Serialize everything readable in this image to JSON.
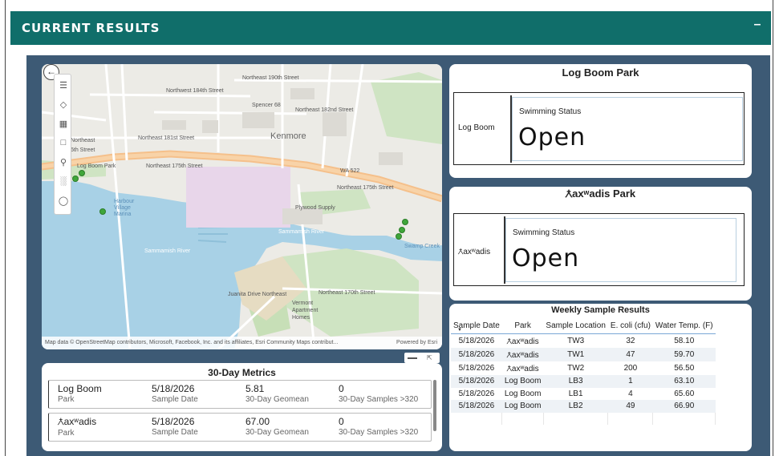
{
  "header": {
    "title": "CURRENT RESULTS",
    "collapse_label": "–"
  },
  "map": {
    "attribution": "Map data © OpenStreetMap contributors, Microsoft, Facebook, Inc. and its affiliates, Esri Community Maps contribut...",
    "powered_by": "Powered by Esri",
    "back_icon": "back-arrow-icon",
    "tools": [
      "menu-icon",
      "layers-icon",
      "basemap-icon",
      "select-icon",
      "search-icon",
      "legend-icon",
      "person-icon"
    ],
    "labels": {
      "kenmore": "Kenmore",
      "spencer": "Spencer 68",
      "log_boom_park": "Log Boom Park",
      "plywood": "Plywood Supply",
      "sammamish_river": "Sammamish River",
      "sammamish_river2": "Sammamish River",
      "wa522": "WA 522",
      "ne_175th": "Northeast 175th Street",
      "ne_175th_b": "Northeast 175th Street",
      "ne_181st": "Northeast 181st Street",
      "ne_182nd": "Northeast 182nd Street",
      "ne_184th": "Northwest 184th Street",
      "ne_170th": "Northeast 170th Street",
      "ne_190th": "Northeast 190th Street",
      "vermont": "Vermont Apartment Homes",
      "harbour": "Harbour Village Marina",
      "northeast": "Northeast",
      "sixth": "6th Street",
      "swamp_creek": "Swamp Creek",
      "juanita": "Juanita Drive Northeast"
    }
  },
  "metrics": {
    "title": "30-Day Metrics",
    "rows": [
      {
        "park": "Log Boom",
        "park_sub": "Park",
        "date": "5/18/2026",
        "date_sub": "Sample Date",
        "geomean": "5.81",
        "geomean_sub": "30-Day Geomean",
        "samples": "0",
        "samples_sub": "30-Day Samples >320"
      },
      {
        "park": "Ƛaxʷadis",
        "park_sub": "Park",
        "date": "5/18/2026",
        "date_sub": "Sample Date",
        "geomean": "67.00",
        "geomean_sub": "30-Day Geomean",
        "samples": "0",
        "samples_sub": "30-Day Samples >320"
      }
    ]
  },
  "parks": [
    {
      "title": "Log Boom Park",
      "label": "Log Boom",
      "caption": "Swimming Status",
      "status": "Open"
    },
    {
      "title": "Ƛaxʷadis Park",
      "label": "Ƛaxʷadis",
      "caption": "Swimming Status",
      "status": "Open"
    }
  ],
  "weekly": {
    "title": "Weekly Sample Results",
    "columns": [
      "Sample Date",
      "Park",
      "Sample Location",
      "E. coli (cfu)",
      "Water Temp. (F)"
    ],
    "rows": [
      [
        "5/18/2026",
        "Ƛaxʷadis",
        "TW3",
        "32",
        "58.10"
      ],
      [
        "5/18/2026",
        "Ƛaxʷadis",
        "TW1",
        "47",
        "59.70"
      ],
      [
        "5/18/2026",
        "Ƛaxʷadis",
        "TW2",
        "200",
        "56.50"
      ],
      [
        "5/18/2026",
        "Log Boom",
        "LB3",
        "1",
        "63.10"
      ],
      [
        "5/18/2026",
        "Log Boom",
        "LB1",
        "4",
        "65.60"
      ],
      [
        "5/18/2026",
        "Log Boom",
        "LB2",
        "49",
        "66.90"
      ]
    ]
  },
  "colors": {
    "header": "#106e6a",
    "canvas": "#3d5a75",
    "marker": "#3fa63a",
    "table_rule": "#7aa7d6"
  }
}
